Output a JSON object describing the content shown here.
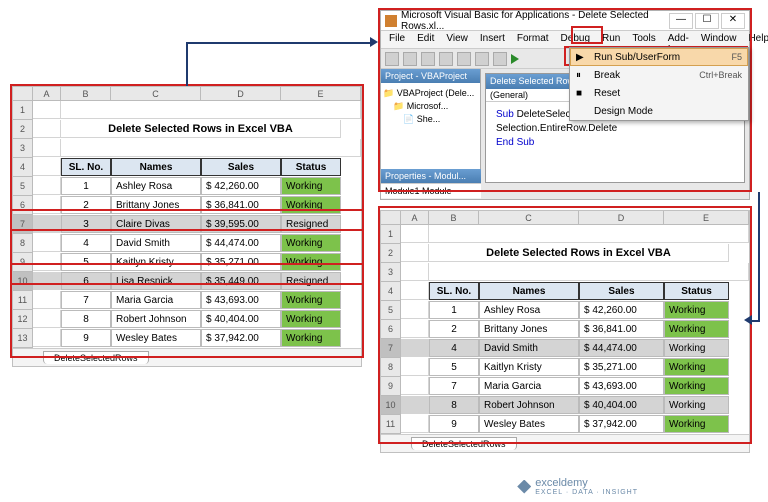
{
  "vba": {
    "title": "Microsoft Visual Basic for Applications - Delete Selected Rows.xl...",
    "menu": [
      "File",
      "Edit",
      "View",
      "Insert",
      "Format",
      "Debug",
      "Run",
      "Tools",
      "Add-Ins",
      "Window",
      "Help"
    ],
    "project_title": "Project - VBAProject",
    "tree": {
      "root": "VBAProject (Dele...",
      "n1": "Microsof...",
      "n2": "She..."
    },
    "props_title": "Properties - Modul...",
    "props_row": "Module1 Module",
    "codewin_title": "Delete Selected Rows...",
    "code_sel_left": "(General)",
    "code": {
      "l1a": "Sub",
      "l1b": " DeleteSelectedRows()",
      "l2": "Selection.EntireRow.Delete",
      "l3": "End Sub"
    },
    "run_menu": [
      {
        "icon": "▶",
        "label": "Run Sub/UserForm",
        "shortcut": "F5",
        "sel": true
      },
      {
        "icon": "⏸",
        "label": "Break",
        "shortcut": "Ctrl+Break",
        "sel": false
      },
      {
        "icon": "■",
        "label": "Reset",
        "shortcut": "",
        "sel": false
      },
      {
        "icon": "",
        "label": "Design Mode",
        "shortcut": "",
        "sel": false
      }
    ],
    "winbtns": [
      "—",
      "☐",
      "✕"
    ]
  },
  "excel_cols": [
    "",
    "A",
    "B",
    "C",
    "D",
    "E"
  ],
  "excel_title": "Delete Selected Rows in Excel VBA",
  "headers": [
    "SL. No.",
    "Names",
    "Sales",
    "Status"
  ],
  "before_rows": [
    {
      "n": "1",
      "name": "Ashley Rosa",
      "sales": "$  42,260.00",
      "status": "Working",
      "sc": "status-w"
    },
    {
      "n": "2",
      "name": "Brittany Jones",
      "sales": "$  36,841.00",
      "status": "Working",
      "sc": "status-w"
    },
    {
      "n": "3",
      "name": "Claire Divas",
      "sales": "$  39,595.00",
      "status": "Resigned",
      "sc": "status-r",
      "sel": true
    },
    {
      "n": "4",
      "name": "David Smith",
      "sales": "$  44,474.00",
      "status": "Working",
      "sc": "status-w"
    },
    {
      "n": "5",
      "name": "Kaitlyn Kristy",
      "sales": "$  35,271.00",
      "status": "Working",
      "sc": "status-w"
    },
    {
      "n": "6",
      "name": "Lisa Resnick",
      "sales": "$  35,449.00",
      "status": "Resigned",
      "sc": "status-r",
      "sel": true
    },
    {
      "n": "7",
      "name": "Maria Garcia",
      "sales": "$  43,693.00",
      "status": "Working",
      "sc": "status-w"
    },
    {
      "n": "8",
      "name": "Robert Johnson",
      "sales": "$  40,404.00",
      "status": "Working",
      "sc": "status-w"
    },
    {
      "n": "9",
      "name": "Wesley Bates",
      "sales": "$  37,942.00",
      "status": "Working",
      "sc": "status-w"
    }
  ],
  "after_rows": [
    {
      "n": "1",
      "name": "Ashley Rosa",
      "sales": "$  42,260.00",
      "status": "Working",
      "sc": "status-w"
    },
    {
      "n": "2",
      "name": "Brittany Jones",
      "sales": "$  36,841.00",
      "status": "Working",
      "sc": "status-w"
    },
    {
      "n": "4",
      "name": "David Smith",
      "sales": "$  44,474.00",
      "status": "Working",
      "sc": "status-w2",
      "sel": true
    },
    {
      "n": "5",
      "name": "Kaitlyn Kristy",
      "sales": "$  35,271.00",
      "status": "Working",
      "sc": "status-w"
    },
    {
      "n": "7",
      "name": "Maria Garcia",
      "sales": "$  43,693.00",
      "status": "Working",
      "sc": "status-w"
    },
    {
      "n": "8",
      "name": "Robert Johnson",
      "sales": "$  40,404.00",
      "status": "Working",
      "sc": "status-w2",
      "sel": true
    },
    {
      "n": "9",
      "name": "Wesley Bates",
      "sales": "$  37,942.00",
      "status": "Working",
      "sc": "status-w"
    }
  ],
  "sheet_tab": "DeleteSelectedRows",
  "watermark": {
    "name": "exceldemy",
    "sub": "EXCEL · DATA · INSIGHT"
  }
}
